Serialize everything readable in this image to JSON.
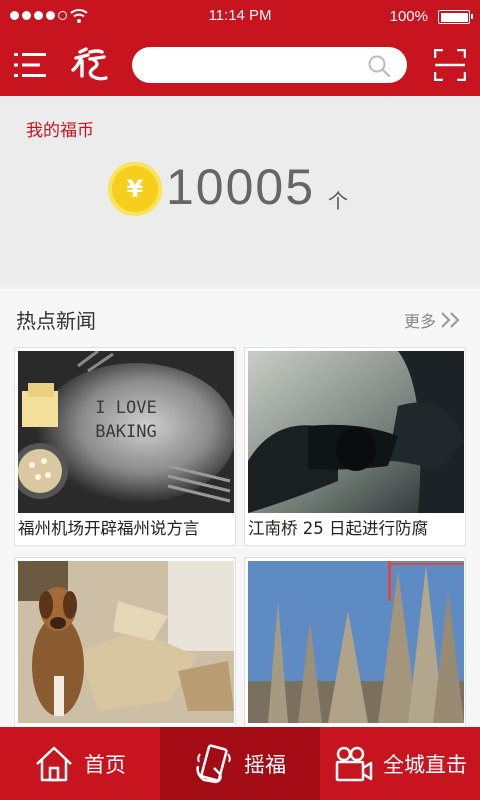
{
  "status_bar": {
    "time": "11:14 PM",
    "battery": "100%",
    "signal_icon": "signal-dots-icon",
    "wifi_icon": "wifi-icon",
    "battery_level": 1.0
  },
  "header": {
    "logo_icon": "fu-logo-icon",
    "menu_icon": "menu-icon",
    "search": {
      "placeholder": "",
      "value": ""
    },
    "search_icon": "search-icon",
    "scan_icon": "scan-icon"
  },
  "coins": {
    "title": "我的福币",
    "symbol": "¥",
    "amount": "10005",
    "unit": "个"
  },
  "news": {
    "title": "热点新闻",
    "more": "更多",
    "items": [
      {
        "caption": "福州机场开辟福州说方言",
        "image": "baking-photo"
      },
      {
        "caption": "江南桥 25 日起进行防腐",
        "image": "bow-photo"
      },
      {
        "caption": "",
        "image": "dog-photo"
      },
      {
        "caption": "",
        "image": "cathedral-photo"
      }
    ]
  },
  "bottom_nav": {
    "items": [
      {
        "label": "首页",
        "icon": "home-icon",
        "active": false
      },
      {
        "label": "摇福",
        "icon": "shake-phone-icon",
        "active": true
      },
      {
        "label": "全城直击",
        "icon": "video-camera-icon",
        "active": false
      }
    ]
  },
  "colors": {
    "brand_red": "#c8141e",
    "active_red": "#a30c15",
    "coin_gold": "#f5cf1c"
  }
}
